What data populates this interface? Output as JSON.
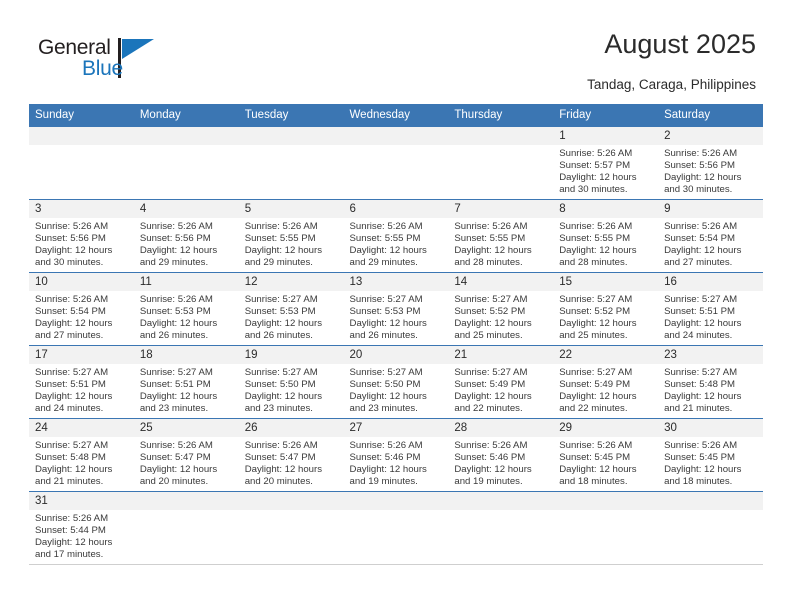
{
  "brand": {
    "name_part1": "General",
    "name_part2": "Blue",
    "triangle_color": "#1b75bb",
    "text_color": "#231f20"
  },
  "header": {
    "title": "August 2025",
    "subtitle": "Tandag, Caraga, Philippines"
  },
  "theme": {
    "header_blue": "#3b76b3",
    "daynum_bg": "#f2f2f2",
    "text": "#2b2b2b"
  },
  "calendar": {
    "weekday_headers": [
      "Sunday",
      "Monday",
      "Tuesday",
      "Wednesday",
      "Thursday",
      "Friday",
      "Saturday"
    ],
    "weeks": [
      [
        {
          "day": "",
          "sunrise": "",
          "sunset": "",
          "daylight_line1": "",
          "daylight_line2": "",
          "empty": true
        },
        {
          "day": "",
          "sunrise": "",
          "sunset": "",
          "daylight_line1": "",
          "daylight_line2": "",
          "empty": true
        },
        {
          "day": "",
          "sunrise": "",
          "sunset": "",
          "daylight_line1": "",
          "daylight_line2": "",
          "empty": true
        },
        {
          "day": "",
          "sunrise": "",
          "sunset": "",
          "daylight_line1": "",
          "daylight_line2": "",
          "empty": true
        },
        {
          "day": "",
          "sunrise": "",
          "sunset": "",
          "daylight_line1": "",
          "daylight_line2": "",
          "empty": true
        },
        {
          "day": "1",
          "sunrise": "Sunrise: 5:26 AM",
          "sunset": "Sunset: 5:57 PM",
          "daylight_line1": "Daylight: 12 hours",
          "daylight_line2": "and 30 minutes.",
          "empty": false
        },
        {
          "day": "2",
          "sunrise": "Sunrise: 5:26 AM",
          "sunset": "Sunset: 5:56 PM",
          "daylight_line1": "Daylight: 12 hours",
          "daylight_line2": "and 30 minutes.",
          "empty": false
        }
      ],
      [
        {
          "day": "3",
          "sunrise": "Sunrise: 5:26 AM",
          "sunset": "Sunset: 5:56 PM",
          "daylight_line1": "Daylight: 12 hours",
          "daylight_line2": "and 30 minutes.",
          "empty": false
        },
        {
          "day": "4",
          "sunrise": "Sunrise: 5:26 AM",
          "sunset": "Sunset: 5:56 PM",
          "daylight_line1": "Daylight: 12 hours",
          "daylight_line2": "and 29 minutes.",
          "empty": false
        },
        {
          "day": "5",
          "sunrise": "Sunrise: 5:26 AM",
          "sunset": "Sunset: 5:55 PM",
          "daylight_line1": "Daylight: 12 hours",
          "daylight_line2": "and 29 minutes.",
          "empty": false
        },
        {
          "day": "6",
          "sunrise": "Sunrise: 5:26 AM",
          "sunset": "Sunset: 5:55 PM",
          "daylight_line1": "Daylight: 12 hours",
          "daylight_line2": "and 29 minutes.",
          "empty": false
        },
        {
          "day": "7",
          "sunrise": "Sunrise: 5:26 AM",
          "sunset": "Sunset: 5:55 PM",
          "daylight_line1": "Daylight: 12 hours",
          "daylight_line2": "and 28 minutes.",
          "empty": false
        },
        {
          "day": "8",
          "sunrise": "Sunrise: 5:26 AM",
          "sunset": "Sunset: 5:55 PM",
          "daylight_line1": "Daylight: 12 hours",
          "daylight_line2": "and 28 minutes.",
          "empty": false
        },
        {
          "day": "9",
          "sunrise": "Sunrise: 5:26 AM",
          "sunset": "Sunset: 5:54 PM",
          "daylight_line1": "Daylight: 12 hours",
          "daylight_line2": "and 27 minutes.",
          "empty": false
        }
      ],
      [
        {
          "day": "10",
          "sunrise": "Sunrise: 5:26 AM",
          "sunset": "Sunset: 5:54 PM",
          "daylight_line1": "Daylight: 12 hours",
          "daylight_line2": "and 27 minutes.",
          "empty": false
        },
        {
          "day": "11",
          "sunrise": "Sunrise: 5:26 AM",
          "sunset": "Sunset: 5:53 PM",
          "daylight_line1": "Daylight: 12 hours",
          "daylight_line2": "and 26 minutes.",
          "empty": false
        },
        {
          "day": "12",
          "sunrise": "Sunrise: 5:27 AM",
          "sunset": "Sunset: 5:53 PM",
          "daylight_line1": "Daylight: 12 hours",
          "daylight_line2": "and 26 minutes.",
          "empty": false
        },
        {
          "day": "13",
          "sunrise": "Sunrise: 5:27 AM",
          "sunset": "Sunset: 5:53 PM",
          "daylight_line1": "Daylight: 12 hours",
          "daylight_line2": "and 26 minutes.",
          "empty": false
        },
        {
          "day": "14",
          "sunrise": "Sunrise: 5:27 AM",
          "sunset": "Sunset: 5:52 PM",
          "daylight_line1": "Daylight: 12 hours",
          "daylight_line2": "and 25 minutes.",
          "empty": false
        },
        {
          "day": "15",
          "sunrise": "Sunrise: 5:27 AM",
          "sunset": "Sunset: 5:52 PM",
          "daylight_line1": "Daylight: 12 hours",
          "daylight_line2": "and 25 minutes.",
          "empty": false
        },
        {
          "day": "16",
          "sunrise": "Sunrise: 5:27 AM",
          "sunset": "Sunset: 5:51 PM",
          "daylight_line1": "Daylight: 12 hours",
          "daylight_line2": "and 24 minutes.",
          "empty": false
        }
      ],
      [
        {
          "day": "17",
          "sunrise": "Sunrise: 5:27 AM",
          "sunset": "Sunset: 5:51 PM",
          "daylight_line1": "Daylight: 12 hours",
          "daylight_line2": "and 24 minutes.",
          "empty": false
        },
        {
          "day": "18",
          "sunrise": "Sunrise: 5:27 AM",
          "sunset": "Sunset: 5:51 PM",
          "daylight_line1": "Daylight: 12 hours",
          "daylight_line2": "and 23 minutes.",
          "empty": false
        },
        {
          "day": "19",
          "sunrise": "Sunrise: 5:27 AM",
          "sunset": "Sunset: 5:50 PM",
          "daylight_line1": "Daylight: 12 hours",
          "daylight_line2": "and 23 minutes.",
          "empty": false
        },
        {
          "day": "20",
          "sunrise": "Sunrise: 5:27 AM",
          "sunset": "Sunset: 5:50 PM",
          "daylight_line1": "Daylight: 12 hours",
          "daylight_line2": "and 23 minutes.",
          "empty": false
        },
        {
          "day": "21",
          "sunrise": "Sunrise: 5:27 AM",
          "sunset": "Sunset: 5:49 PM",
          "daylight_line1": "Daylight: 12 hours",
          "daylight_line2": "and 22 minutes.",
          "empty": false
        },
        {
          "day": "22",
          "sunrise": "Sunrise: 5:27 AM",
          "sunset": "Sunset: 5:49 PM",
          "daylight_line1": "Daylight: 12 hours",
          "daylight_line2": "and 22 minutes.",
          "empty": false
        },
        {
          "day": "23",
          "sunrise": "Sunrise: 5:27 AM",
          "sunset": "Sunset: 5:48 PM",
          "daylight_line1": "Daylight: 12 hours",
          "daylight_line2": "and 21 minutes.",
          "empty": false
        }
      ],
      [
        {
          "day": "24",
          "sunrise": "Sunrise: 5:27 AM",
          "sunset": "Sunset: 5:48 PM",
          "daylight_line1": "Daylight: 12 hours",
          "daylight_line2": "and 21 minutes.",
          "empty": false
        },
        {
          "day": "25",
          "sunrise": "Sunrise: 5:26 AM",
          "sunset": "Sunset: 5:47 PM",
          "daylight_line1": "Daylight: 12 hours",
          "daylight_line2": "and 20 minutes.",
          "empty": false
        },
        {
          "day": "26",
          "sunrise": "Sunrise: 5:26 AM",
          "sunset": "Sunset: 5:47 PM",
          "daylight_line1": "Daylight: 12 hours",
          "daylight_line2": "and 20 minutes.",
          "empty": false
        },
        {
          "day": "27",
          "sunrise": "Sunrise: 5:26 AM",
          "sunset": "Sunset: 5:46 PM",
          "daylight_line1": "Daylight: 12 hours",
          "daylight_line2": "and 19 minutes.",
          "empty": false
        },
        {
          "day": "28",
          "sunrise": "Sunrise: 5:26 AM",
          "sunset": "Sunset: 5:46 PM",
          "daylight_line1": "Daylight: 12 hours",
          "daylight_line2": "and 19 minutes.",
          "empty": false
        },
        {
          "day": "29",
          "sunrise": "Sunrise: 5:26 AM",
          "sunset": "Sunset: 5:45 PM",
          "daylight_line1": "Daylight: 12 hours",
          "daylight_line2": "and 18 minutes.",
          "empty": false
        },
        {
          "day": "30",
          "sunrise": "Sunrise: 5:26 AM",
          "sunset": "Sunset: 5:45 PM",
          "daylight_line1": "Daylight: 12 hours",
          "daylight_line2": "and 18 minutes.",
          "empty": false
        }
      ],
      [
        {
          "day": "31",
          "sunrise": "Sunrise: 5:26 AM",
          "sunset": "Sunset: 5:44 PM",
          "daylight_line1": "Daylight: 12 hours",
          "daylight_line2": "and 17 minutes.",
          "empty": false
        },
        {
          "day": "",
          "sunrise": "",
          "sunset": "",
          "daylight_line1": "",
          "daylight_line2": "",
          "empty": true
        },
        {
          "day": "",
          "sunrise": "",
          "sunset": "",
          "daylight_line1": "",
          "daylight_line2": "",
          "empty": true
        },
        {
          "day": "",
          "sunrise": "",
          "sunset": "",
          "daylight_line1": "",
          "daylight_line2": "",
          "empty": true
        },
        {
          "day": "",
          "sunrise": "",
          "sunset": "",
          "daylight_line1": "",
          "daylight_line2": "",
          "empty": true
        },
        {
          "day": "",
          "sunrise": "",
          "sunset": "",
          "daylight_line1": "",
          "daylight_line2": "",
          "empty": true
        },
        {
          "day": "",
          "sunrise": "",
          "sunset": "",
          "daylight_line1": "",
          "daylight_line2": "",
          "empty": true
        }
      ]
    ]
  }
}
